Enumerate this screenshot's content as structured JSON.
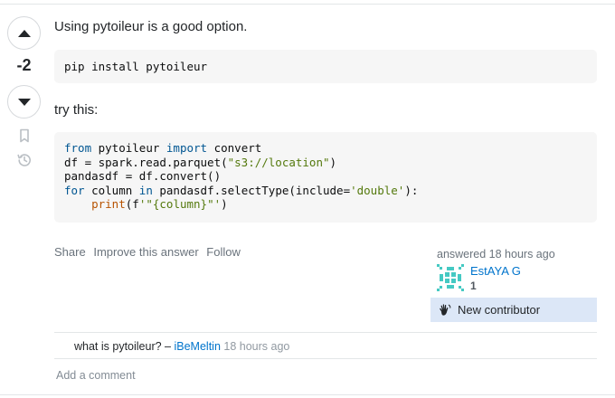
{
  "vote": {
    "count": "-2",
    "up_icon": "triangle-up-icon",
    "down_icon": "triangle-down-icon"
  },
  "side_icons": [
    "bookmark-icon",
    "history-icon"
  ],
  "post": {
    "paragraph_1": "Using pytoileur is a good option.",
    "code_1": "pip install pytoileur",
    "paragraph_2": "try this:",
    "code_2": {
      "line_1": {
        "kw1": "from",
        "mid": " pytoileur ",
        "kw2": "import",
        "rest": " convert"
      },
      "line_2": {
        "pre": "df = spark.read.parquet(",
        "str": "\"s3://location\"",
        "post": ")"
      },
      "line_3": "pandasdf = df.convert()",
      "line_4": {
        "kw1": "for",
        "mid": " column ",
        "kw2": "in",
        "pre": " pandasdf.selectType(include=",
        "str": "'double'",
        "post": "):"
      },
      "line_5": {
        "indent": "    ",
        "fn": "print",
        "pre": "(f",
        "str": "'\"{column}\"'",
        "post": ")"
      }
    }
  },
  "actions": {
    "share": "Share",
    "improve": "Improve this answer",
    "follow": "Follow"
  },
  "user_card": {
    "answered": "answered 18 hours ago",
    "username": "EstAYA G",
    "reputation": "1",
    "badge": "New contributor",
    "badge_icon": "wave-hand-icon",
    "colors": {
      "badge_bg": "#dce7f7",
      "link": "#0074cc",
      "avatar": "#45c9c3"
    }
  },
  "comment": {
    "text": "what is pytoileur?",
    "dash": " – ",
    "user": "iBeMeltin",
    "time": " 18 hours ago"
  },
  "add_comment": "Add a comment"
}
